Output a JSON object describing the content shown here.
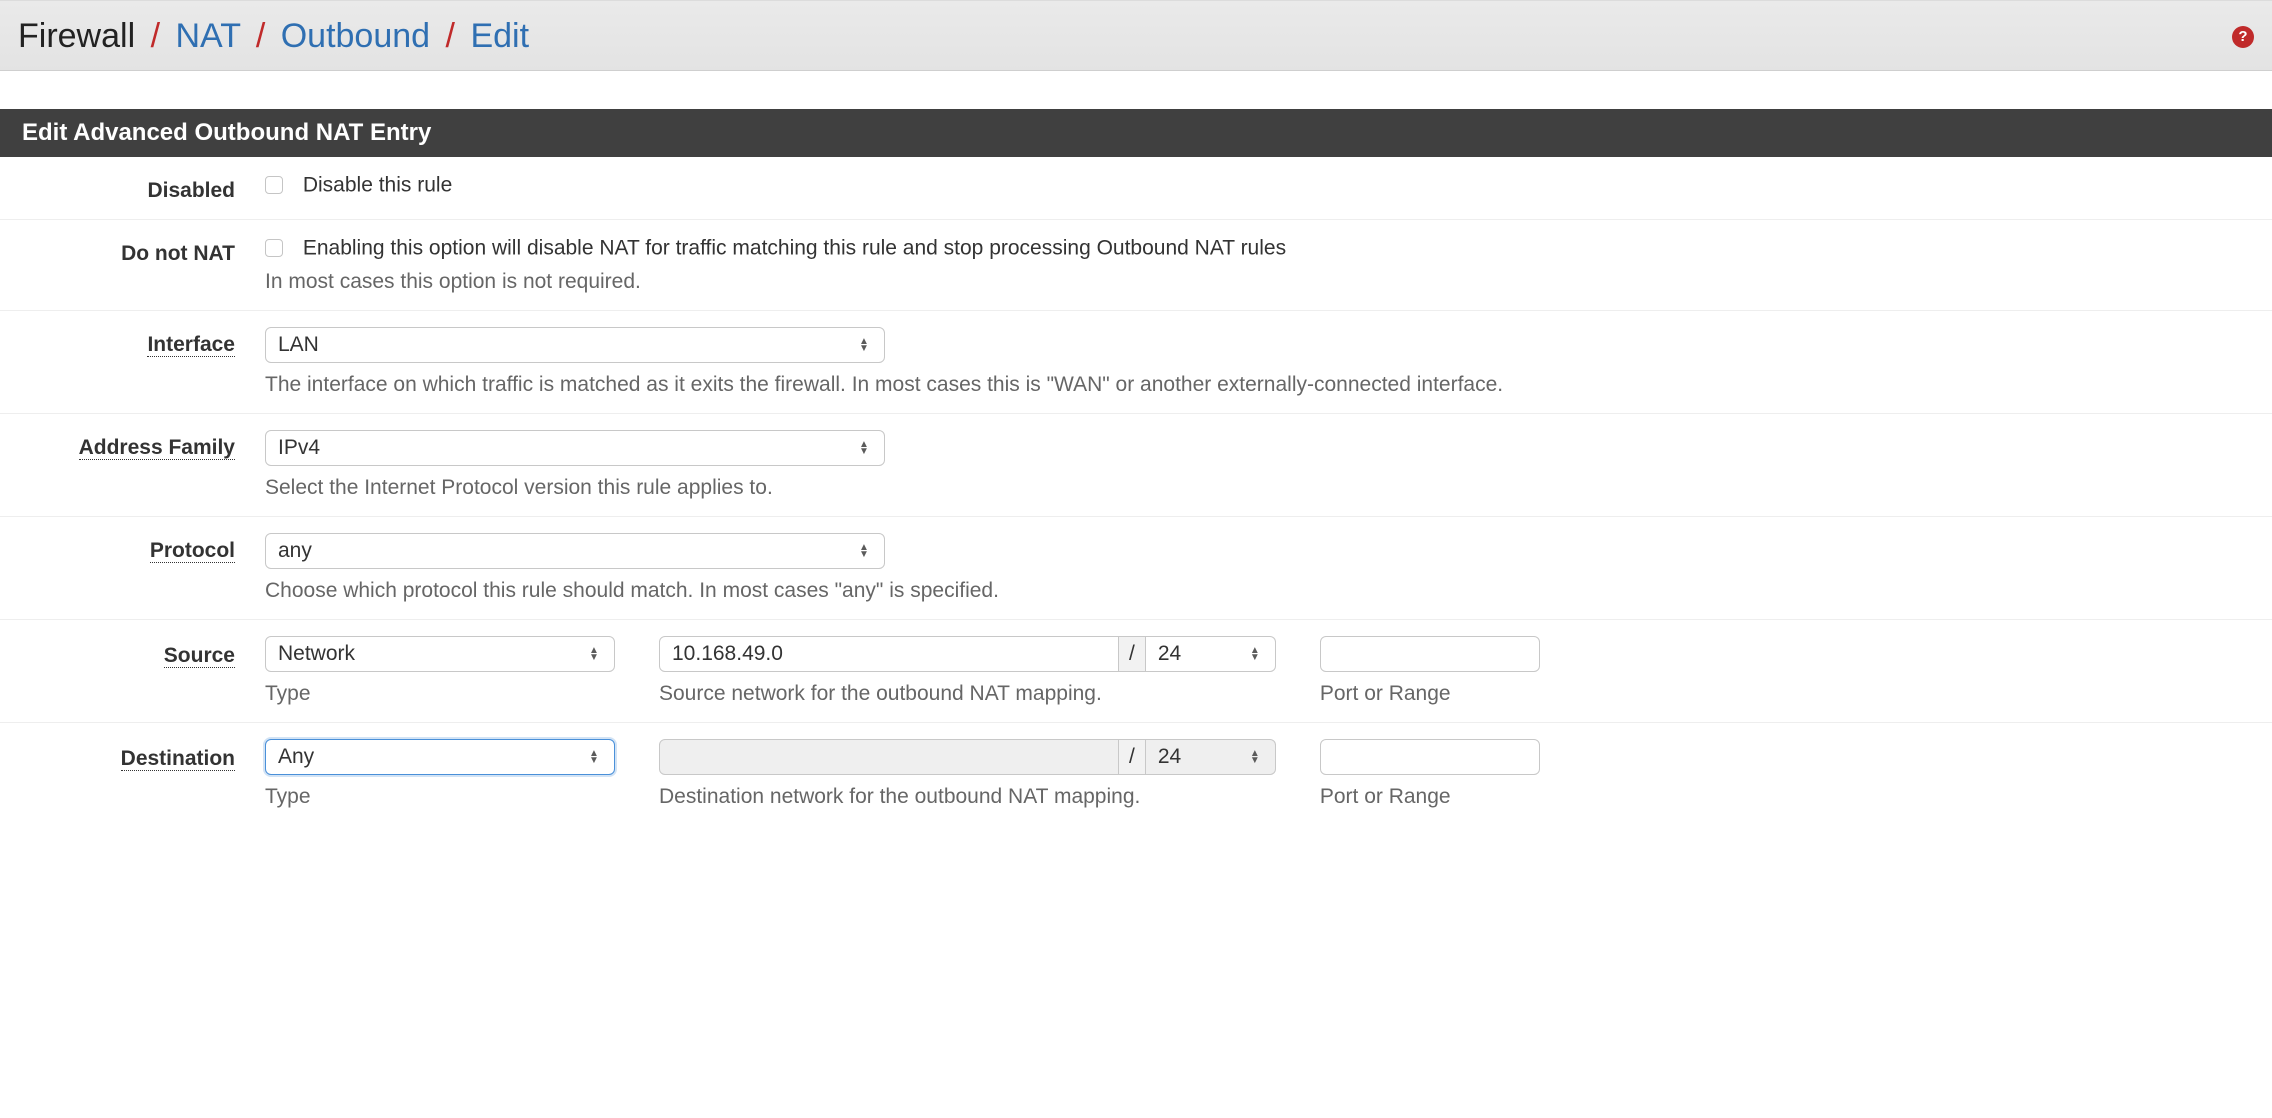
{
  "breadcrumb": {
    "first": "Firewall",
    "items": [
      "NAT",
      "Outbound",
      "Edit"
    ]
  },
  "help_icon_glyph": "?",
  "panel_title": "Edit Advanced Outbound NAT Entry",
  "rows": {
    "disabled": {
      "label": "Disabled",
      "checkbox_label": "Disable this rule"
    },
    "donat": {
      "label": "Do not NAT",
      "checkbox_label": "Enabling this option will disable NAT for traffic matching this rule and stop processing Outbound NAT rules",
      "help": "In most cases this option is not required."
    },
    "interface": {
      "label": "Interface",
      "value": "LAN",
      "help": "The interface on which traffic is matched as it exits the firewall. In most cases this is \"WAN\" or another externally-connected interface."
    },
    "address_family": {
      "label": "Address Family",
      "value": "IPv4",
      "help": "Select the Internet Protocol version this rule applies to."
    },
    "protocol": {
      "label": "Protocol",
      "value": "any",
      "help": "Choose which protocol this rule should match. In most cases \"any\" is specified."
    },
    "source": {
      "label": "Source",
      "type_value": "Network",
      "type_caption": "Type",
      "net_value": "10.168.49.0",
      "slash": "/",
      "mask_value": "24",
      "net_caption": "Source network for the outbound NAT mapping.",
      "port_caption": "Port or Range",
      "port_value": ""
    },
    "destination": {
      "label": "Destination",
      "type_value": "Any",
      "type_caption": "Type",
      "net_value": "",
      "slash": "/",
      "mask_value": "24",
      "net_caption": "Destination network for the outbound NAT mapping.",
      "port_caption": "Port or Range",
      "port_value": ""
    }
  }
}
